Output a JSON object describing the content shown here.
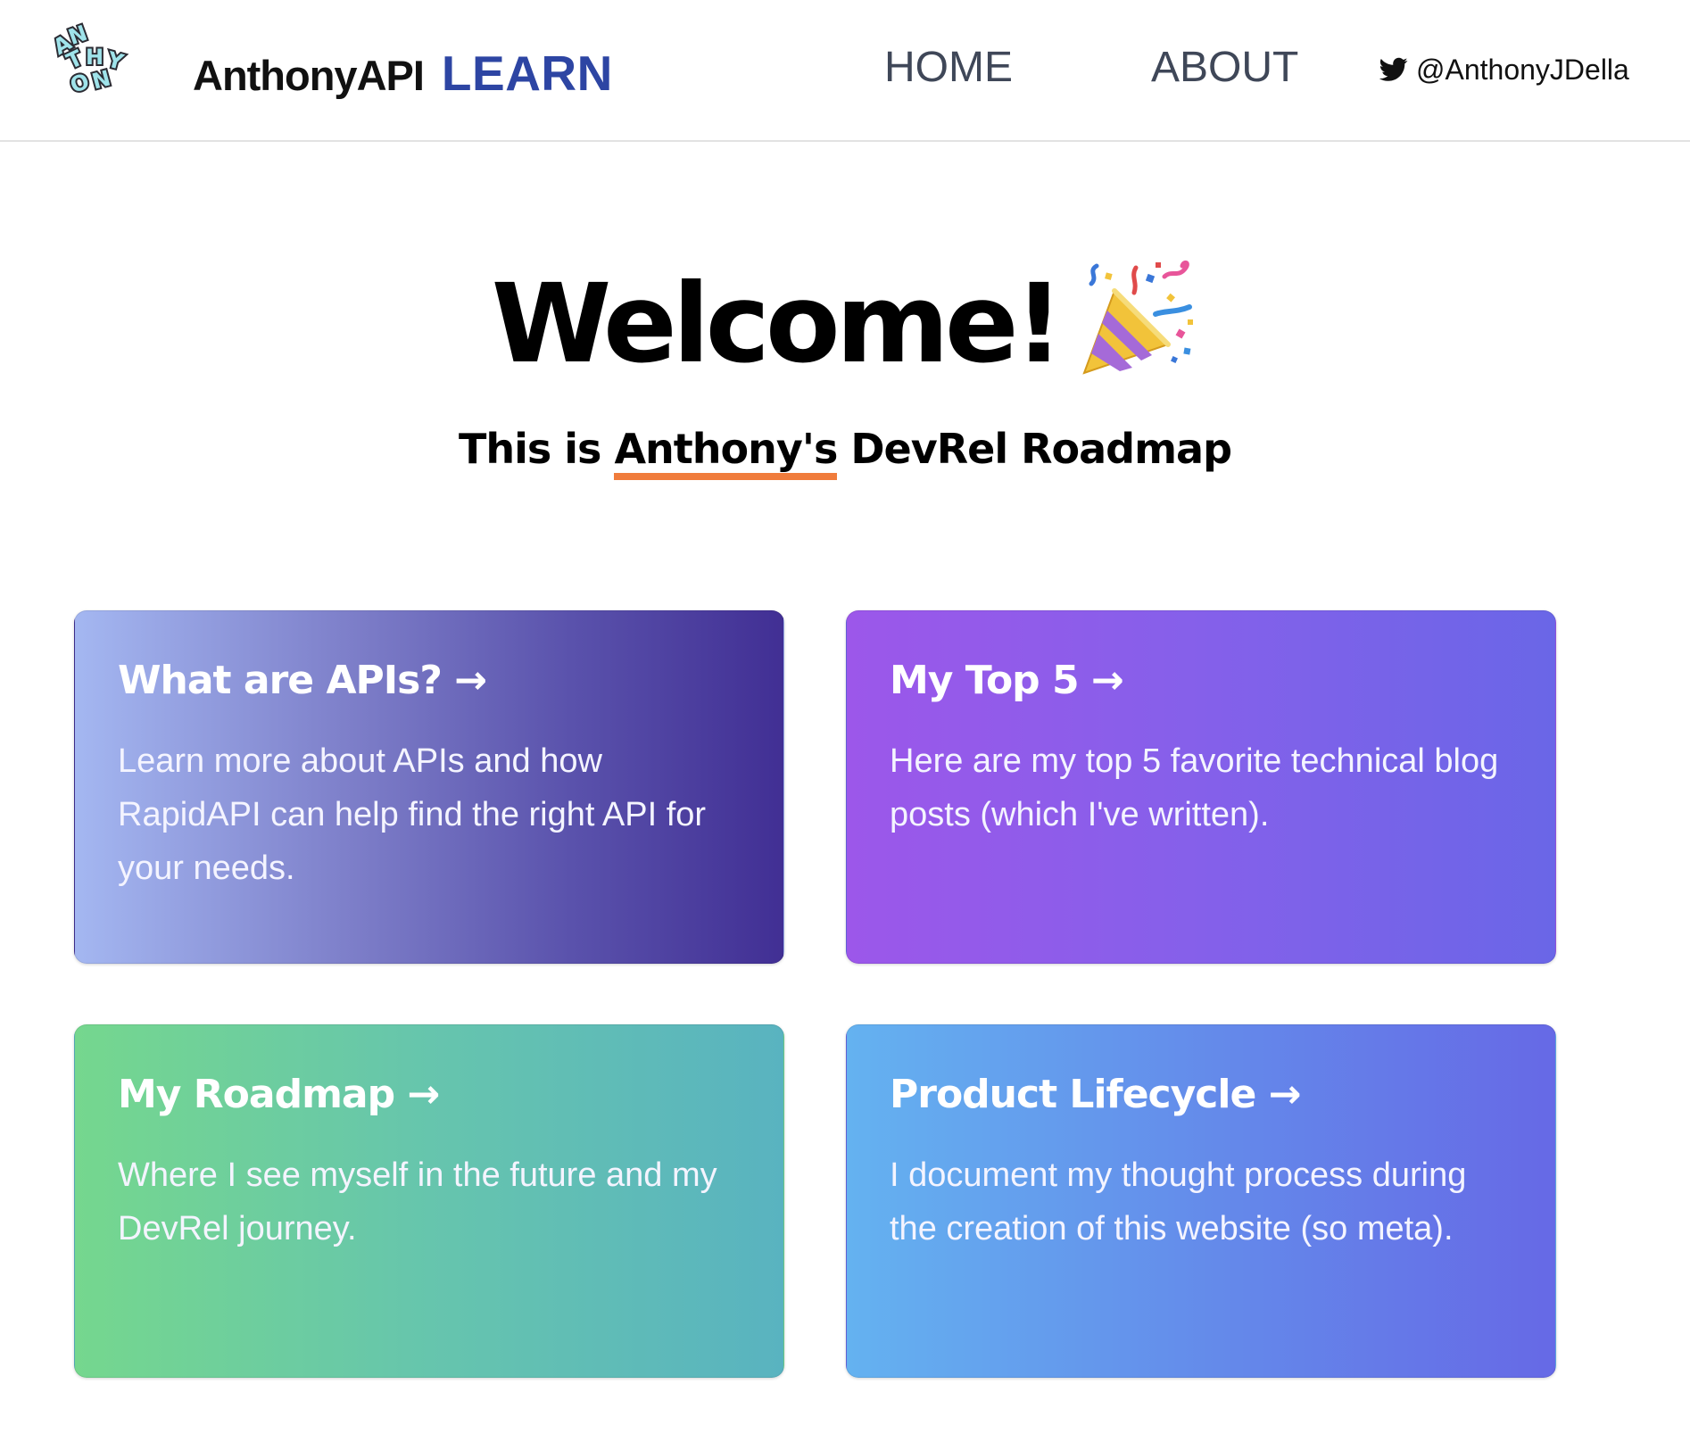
{
  "header": {
    "logo_icon": "anthony-logo-icon",
    "logo_letters": "ANTHONY",
    "brand_name": "AnthonyAPI",
    "brand_sub": "LEARN",
    "brand_sub_color": "#2d45a3",
    "nav": [
      {
        "label": "HOME"
      },
      {
        "label": "ABOUT"
      }
    ],
    "twitter_icon": "twitter-bird-icon",
    "twitter_handle": "@AnthonyJDella"
  },
  "hero": {
    "title": "Welcome!",
    "title_icon": "party-popper-icon",
    "subtitle_prefix": "This is ",
    "subtitle_highlight": "Anthony's",
    "subtitle_suffix": " DevRel Roadmap",
    "highlight_color": "#f07c3c"
  },
  "cards": [
    {
      "title": "What are APIs? →",
      "text": "Learn more about APIs and how RapidAPI can help find the right API for your needs.",
      "gradient": [
        "#a4b7f1",
        "#412f94"
      ]
    },
    {
      "title": "My Top 5 →",
      "text": "Here are my top 5 favorite technical blog posts (which I've written).",
      "gradient": [
        "#9c57ea",
        "#6a66e7"
      ]
    },
    {
      "title": "My Roadmap →",
      "text": "Where I see myself in the future and my DevRel journey.",
      "gradient": [
        "#75d78e",
        "#59b3c0"
      ]
    },
    {
      "title": "Product Lifecycle →",
      "text": "I document my thought process during the creation of this website (so meta).",
      "gradient": [
        "#64b2f0",
        "#6669e6"
      ]
    }
  ]
}
